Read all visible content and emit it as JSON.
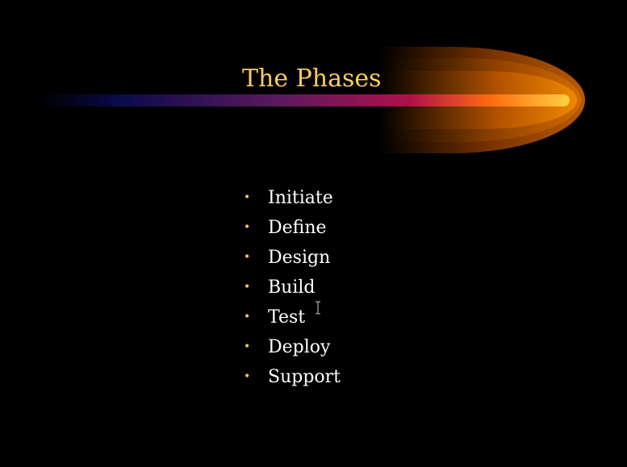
{
  "slide": {
    "title": "The Phases",
    "bullets": [
      "Initiate",
      "Define",
      "Design",
      "Build",
      "Test",
      "Deploy",
      "Support"
    ],
    "bullet_glyph": "•"
  },
  "icons": {
    "cursor": "text-cursor-icon"
  },
  "colors": {
    "background": "#000000",
    "title": "#ffcc66",
    "bullet_text": "#ffffff",
    "bullet_glyph": "#ffcc66",
    "streak_start": "#000033",
    "streak_mid": "#990066",
    "streak_end": "#ffcc33",
    "comet": "#cc6600"
  }
}
